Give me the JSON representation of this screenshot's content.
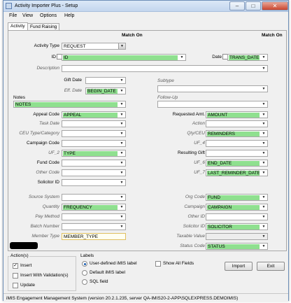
{
  "window": {
    "title": "Activity Importer Plus - Setup",
    "minimize": "–",
    "maximize": "□",
    "close": "✕"
  },
  "menu": [
    "File",
    "View",
    "Options",
    "Help"
  ],
  "tabs": [
    "Activity",
    "Fund Raising"
  ],
  "headers": {
    "left_match_on": "Match On",
    "right_match_on": "Match On"
  },
  "fields": {
    "activity_type": {
      "label": "Activity Type",
      "value": "REQUEST"
    },
    "id": {
      "label": "ID",
      "value": "ID"
    },
    "date": {
      "label": "Date",
      "value": "TRANS_DATE"
    },
    "description": {
      "label": "Description",
      "value": ""
    },
    "gift_date": {
      "label": "Gift Date",
      "value": ""
    },
    "eff_date": {
      "label": "Eff. Date",
      "value": "BEGIN_DATE"
    },
    "subtype": {
      "label": "Subtype",
      "value": ""
    },
    "notes": {
      "label": "Notes",
      "value": "NOTES"
    },
    "follow_up": {
      "label": "Follow-Up",
      "value": ""
    },
    "appeal_code": {
      "label": "Appeal Code",
      "value": "APPEAL"
    },
    "requested_amt": {
      "label": "Requested Amt.",
      "value": "AMOUNT"
    },
    "task_date": {
      "label": "Task Date",
      "value": ""
    },
    "action": {
      "label": "Action",
      "value": ""
    },
    "ceu_type": {
      "label": "CEU Type/Category",
      "value": ""
    },
    "qty_ceu": {
      "label": "Qty/CEU",
      "value": "REMINDERS"
    },
    "campaign_code": {
      "label": "Campaign Code",
      "value": ""
    },
    "uf_4": {
      "label": "UF_4",
      "value": ""
    },
    "uf_2": {
      "label": "UF_2",
      "value": "TYPE"
    },
    "resulting_gift": {
      "label": "Resulting Gift",
      "value": ""
    },
    "fund_code": {
      "label": "Fund Code",
      "value": ""
    },
    "uf_6": {
      "label": "UF_6",
      "value": "END_DATE"
    },
    "other_code": {
      "label": "Other Code",
      "value": ""
    },
    "uf_7": {
      "label": "UF_7",
      "value": "LAST_REMINDER_DATE"
    },
    "solicitor_id": {
      "label": "Solicitor ID",
      "value": ""
    },
    "source_system": {
      "label": "Source System",
      "value": ""
    },
    "org_code": {
      "label": "Org Code",
      "value": "FUND"
    },
    "quantity": {
      "label": "Quantity",
      "value": "FREQUENCY"
    },
    "campaign": {
      "label": "Campaign",
      "value": "CAMPAIGN"
    },
    "pay_method": {
      "label": "Pay Method",
      "value": ""
    },
    "other_id": {
      "label": "Other ID",
      "value": ""
    },
    "batch_number": {
      "label": "Batch Number",
      "value": ""
    },
    "solicitor_id_2": {
      "label": "Solicitor ID",
      "value": "SOLICITOR"
    },
    "member_type": {
      "label": "Member Type",
      "value": "MEMBER_TYPE"
    },
    "taxable_value": {
      "label": "Taxable Value",
      "value": ""
    },
    "status_code": {
      "label": "Status Code",
      "value": "STATUS"
    }
  },
  "actions_group": {
    "title": "Action(s)",
    "insert": {
      "label": "Insert",
      "checked": true
    },
    "insert_with_validation": {
      "label": "Insert With Validation(s)",
      "checked": false
    },
    "update": {
      "label": "Update",
      "checked": false
    }
  },
  "labels_group": {
    "title": "Labels",
    "options": [
      "User-defined iMIS label",
      "Default iMIS label",
      "SQL field"
    ],
    "selected": "User-defined iMIS label"
  },
  "show_all_fields": {
    "label": "Show All Fields",
    "checked": false
  },
  "buttons": {
    "import": "Import",
    "exit": "Exit"
  },
  "status_bar": "iMIS Engagement Management System  (version 20.2.1.235, server QA-IMIS20-2-APP\\SQLEXPRESS.DEMOIMIS)",
  "colors": {
    "mapped_field": "#8fe08f",
    "title_bar": "#c3d6ee"
  }
}
